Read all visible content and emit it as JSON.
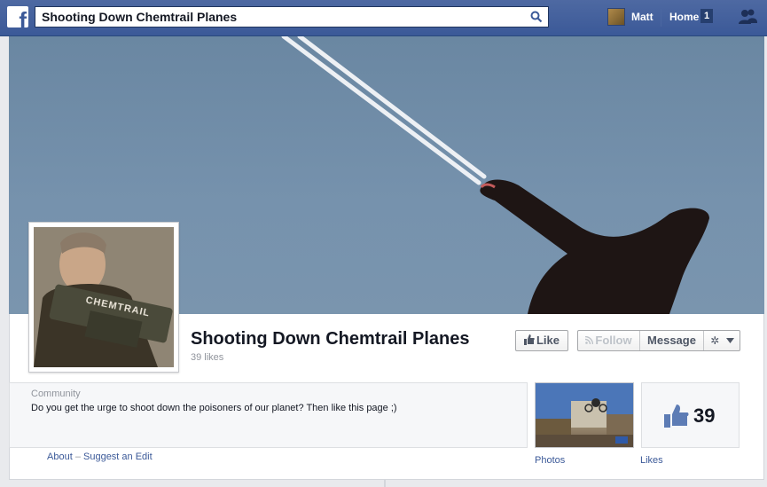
{
  "topbar": {
    "logo_letter": "f",
    "search_value": "Shooting Down Chemtrail Planes",
    "user_name": "Matt",
    "home_label": "Home",
    "home_badge": "1"
  },
  "page": {
    "title": "Shooting Down Chemtrail Planes",
    "likes_text": "39 likes",
    "buttons": {
      "like": "Like",
      "follow": "Follow",
      "message": "Message",
      "gear": "✲"
    }
  },
  "profile_pic": {
    "gun_text": "CHEMTRAIL"
  },
  "about": {
    "category": "Community",
    "description": "Do you get the urge to shoot down the poisoners of our planet? Then like this page ;)",
    "about_link": "About",
    "separator": "–",
    "suggest_link": "Suggest an Edit"
  },
  "widgets": {
    "photos_label": "Photos",
    "likes_count": "39",
    "likes_label": "Likes"
  },
  "colors": {
    "brand": "#3b5998",
    "link": "#3b5998"
  }
}
